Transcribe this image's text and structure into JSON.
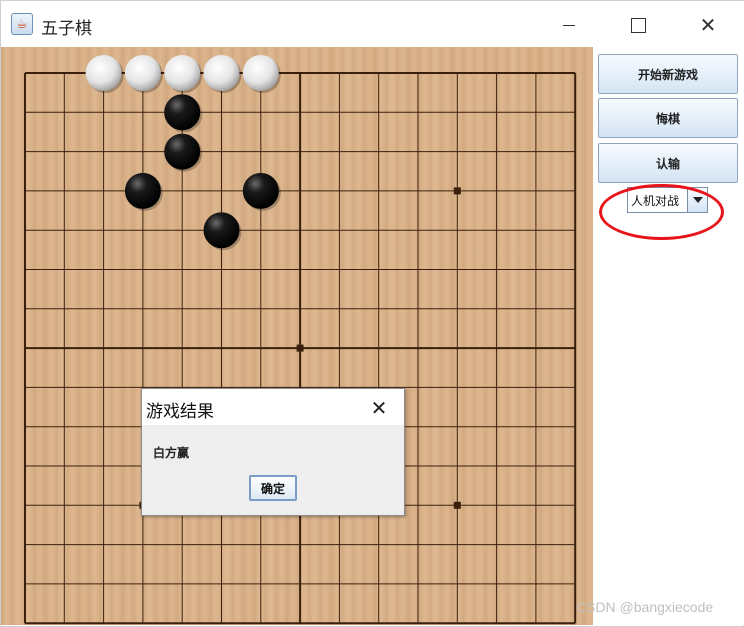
{
  "window": {
    "title": "五子棋",
    "app_icon": "java-cup-icon",
    "controls": [
      "minimize-icon",
      "maximize-icon",
      "close-icon"
    ]
  },
  "board": {
    "grid_lines": 15,
    "star_points": [
      [
        3,
        3
      ],
      [
        3,
        11
      ],
      [
        7,
        7
      ],
      [
        11,
        3
      ],
      [
        11,
        11
      ]
    ],
    "stones": [
      {
        "color": "white",
        "col": 2,
        "row": 0
      },
      {
        "color": "white",
        "col": 3,
        "row": 0
      },
      {
        "color": "white",
        "col": 4,
        "row": 0
      },
      {
        "color": "white",
        "col": 5,
        "row": 0
      },
      {
        "color": "white",
        "col": 6,
        "row": 0
      },
      {
        "color": "black",
        "col": 4,
        "row": 1
      },
      {
        "color": "black",
        "col": 4,
        "row": 2
      },
      {
        "color": "black",
        "col": 3,
        "row": 3
      },
      {
        "color": "black",
        "col": 6,
        "row": 3
      },
      {
        "color": "black",
        "col": 5,
        "row": 4
      }
    ],
    "colors": {
      "wood": "#dcb48c",
      "line": "#3a200c"
    }
  },
  "sidebar": {
    "new_game_label": "开始新游戏",
    "undo_label": "悔棋",
    "resign_label": "认输",
    "mode_value": "人机对战",
    "highlight_color": "#e8141a"
  },
  "dialog": {
    "title": "游戏结果",
    "message": "白方赢",
    "ok_label": "确定"
  },
  "watermark": "CSDN @bangxiecode"
}
